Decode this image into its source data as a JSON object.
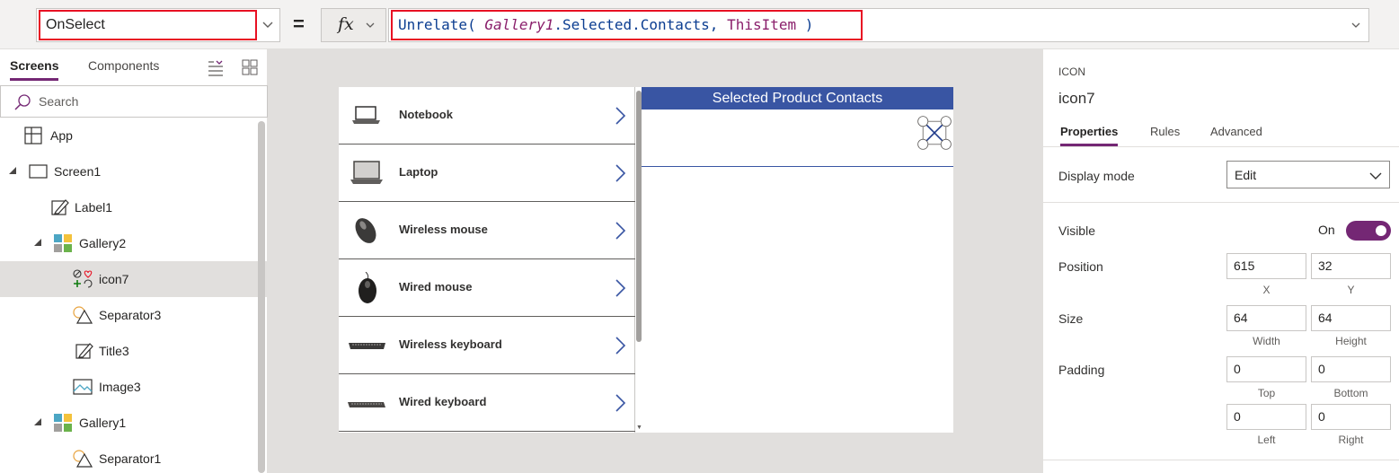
{
  "formula_bar": {
    "property": "OnSelect",
    "equals": "=",
    "fx_label": "fx",
    "formula": {
      "fn": "Unrelate(",
      "arg1_obj": "Gallery1",
      "arg1_rest": ".Selected.Contacts, ",
      "arg2": "ThisItem",
      "close": " )"
    }
  },
  "left_panel": {
    "tabs": {
      "screens": "Screens",
      "components": "Components"
    },
    "search_placeholder": "Search",
    "tree": [
      {
        "label": "App",
        "icon": "app-icon"
      },
      {
        "label": "Screen1",
        "icon": "screen-icon"
      },
      {
        "label": "Label1",
        "icon": "label-icon"
      },
      {
        "label": "Gallery2",
        "icon": "gallery-icon"
      },
      {
        "label": "icon7",
        "icon": "icon-control-icon",
        "selected": true
      },
      {
        "label": "Separator3",
        "icon": "shape-icon"
      },
      {
        "label": "Title3",
        "icon": "label-icon"
      },
      {
        "label": "Image3",
        "icon": "image-icon"
      },
      {
        "label": "Gallery1",
        "icon": "gallery-icon"
      },
      {
        "label": "Separator1",
        "icon": "shape-icon"
      }
    ]
  },
  "canvas": {
    "gallery_items": [
      {
        "title": "Notebook",
        "thumb": "notebook-image"
      },
      {
        "title": "Laptop",
        "thumb": "laptop-image"
      },
      {
        "title": "Wireless mouse",
        "thumb": "wireless-mouse-image"
      },
      {
        "title": "Wired mouse",
        "thumb": "wired-mouse-image"
      },
      {
        "title": "Wireless keyboard",
        "thumb": "wireless-keyboard-image"
      },
      {
        "title": "Wired keyboard",
        "thumb": "wired-keyboard-image"
      }
    ],
    "contacts_title": "Selected Product Contacts"
  },
  "right_panel": {
    "type": "ICON",
    "name": "icon7",
    "tabs": {
      "properties": "Properties",
      "rules": "Rules",
      "advanced": "Advanced"
    },
    "display_mode_label": "Display mode",
    "display_mode_value": "Edit",
    "visible_label": "Visible",
    "visible_value": "On",
    "position_label": "Position",
    "position_x": "615",
    "position_y": "32",
    "x_label": "X",
    "y_label": "Y",
    "size_label": "Size",
    "width_value": "64",
    "height_value": "64",
    "width_label": "Width",
    "height_label": "Height",
    "padding_label": "Padding",
    "padding_top": "0",
    "padding_bottom": "0",
    "padding_left": "0",
    "padding_right": "0",
    "top_label": "Top",
    "bottom_label": "Bottom",
    "left_label": "Left",
    "right_label": "Right"
  },
  "colors": {
    "accent": "#742774",
    "header_blue": "#3955a3",
    "highlight_red": "#e81123"
  }
}
